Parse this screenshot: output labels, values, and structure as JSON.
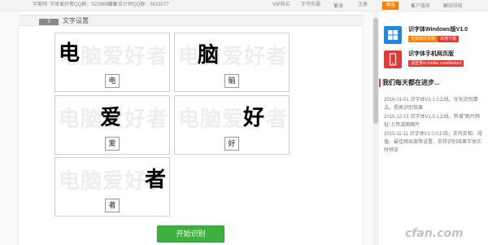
{
  "topbar": {
    "items": [
      {
        "label": "字客网"
      },
      {
        "label": "字体爱好者QQ群：523969613"
      },
      {
        "label": "字体设计师QQ群：5819277"
      }
    ],
    "vip": "VIP购买",
    "software": "字书先霸",
    "login": "登录",
    "register": "注册",
    "blog_btn": "博客",
    "service": "客户服务",
    "sitenav": "网站导航"
  },
  "section": {
    "step": "3",
    "title": "文字设置"
  },
  "cards": [
    {
      "watermark": "电脑爱好者",
      "char": "电",
      "label": "电"
    },
    {
      "watermark": "电脑爱好者",
      "char": "脑",
      "label": "脑"
    },
    {
      "watermark": "电脑爱好者",
      "char": "爱",
      "label": "爱"
    },
    {
      "watermark": "电脑爱好者",
      "char": "好",
      "label": "好"
    },
    {
      "watermark": "电脑爱好者",
      "char": "者",
      "label": "者"
    }
  ],
  "start_button": "开始识别",
  "sidebar": {
    "promos": [
      {
        "title": "识字体Windows版V1.0",
        "tags": [
          "无需软件安装",
          "本地下载"
        ],
        "icon": "windows-icon",
        "color": "#1e88e5"
      },
      {
        "title": "识字体手机网页版",
        "tags": [
          "请登录m.fontke.com/likefont"
        ],
        "icon": "mobile-icon",
        "color": "#e53935"
      }
    ],
    "heading": "我们每天都在进步...",
    "news": [
      "2016-01-01 识字体V1.1.0上线，优化识别算法，提高识别效果",
      "2015-12-15 识字体V1.0.1上线，新增\"图片网址\"上传选图图片",
      "2015-11-11 识字体V1.0.0上线，支持反相、阈值、最佳相似度等设置，支持识别结果字体实时预览"
    ]
  },
  "watermark": "cfan.com",
  "colors": {
    "accent_green": "#3db13d",
    "tag_orange": "#ff7f00",
    "tag_red": "#e53935",
    "heading_bar": "#e03c3c"
  }
}
